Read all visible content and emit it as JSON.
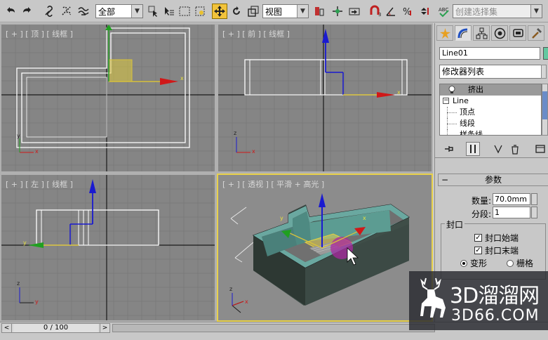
{
  "toolbar": {
    "selection_filter": "全部",
    "ref_coord_system": "视图",
    "named_selection_placeholder": "创建选择集"
  },
  "viewports": {
    "top": {
      "label": "[ + ] [ 顶 ] [ 线框 ]"
    },
    "front": {
      "label": "[ + ] [ 前 ] [ 线框 ]"
    },
    "left": {
      "label": "[ + ] [ 左 ] [ 线框 ]"
    },
    "perspective": {
      "label": "[ + ] [ 透视 ] [ 平滑 + 高光 ]"
    },
    "axis_labels": {
      "x": "x",
      "y": "y",
      "z": "z"
    }
  },
  "command_panel": {
    "object_name": "Line01",
    "object_color": "#64c8a0",
    "modifier_list": "修改器列表",
    "stack": [
      {
        "label": "挤出",
        "selected": true
      },
      {
        "label": "Line",
        "selected": false
      },
      {
        "label": "顶点",
        "selected": false
      },
      {
        "label": "线段",
        "selected": false
      },
      {
        "label": "样条线",
        "selected": false
      }
    ],
    "rollout": {
      "title": "参数",
      "amount_label": "数量:",
      "amount_value": "70.0mm",
      "segments_label": "分段:",
      "segments_value": "1",
      "capping_group": "封口",
      "cap_start_label": "封口始端",
      "cap_end_label": "封口末端",
      "morph_label": "变形",
      "grid_label": "栅格"
    }
  },
  "timeline": {
    "frame_display": "0 / 100"
  },
  "watermark": {
    "brand": "3D溜溜网",
    "domain": "3D66.COM"
  },
  "colors": {
    "accent_yellow": "#e8d14a",
    "gizmo_red": "#e02020",
    "gizmo_green": "#20a020",
    "gizmo_blue": "#2040e0",
    "wall_teal": "#5a9a94"
  }
}
